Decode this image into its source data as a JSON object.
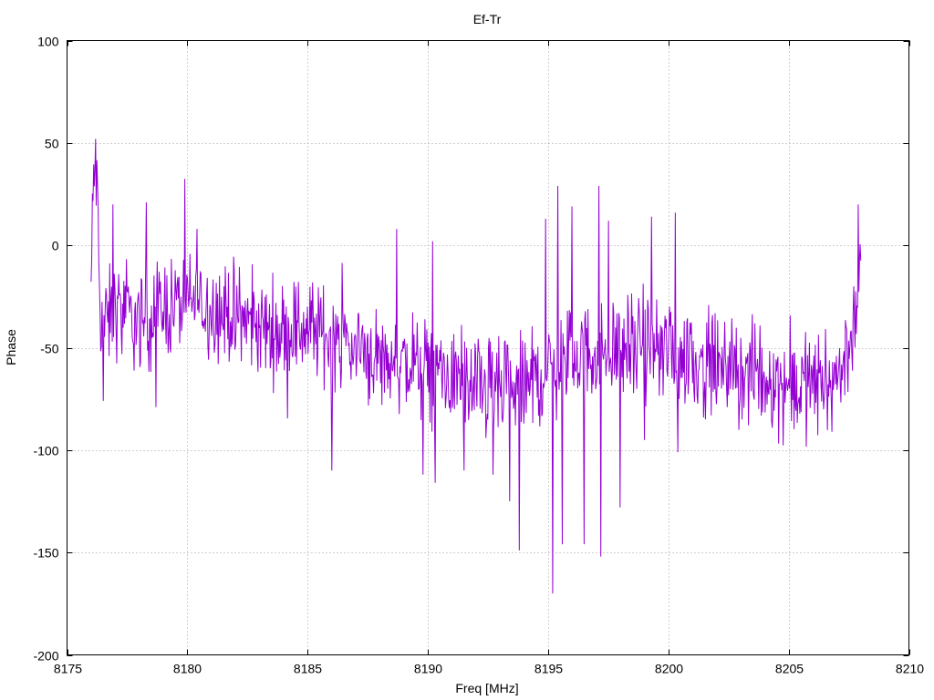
{
  "chart_data": {
    "type": "line",
    "title": "Ef-Tr",
    "xlabel": "Freq [MHz]",
    "ylabel": "Phase",
    "xlim": [
      8175,
      8210
    ],
    "ylim": [
      -200,
      100
    ],
    "xticks": [
      8175,
      8180,
      8185,
      8190,
      8195,
      8200,
      8205,
      8210
    ],
    "yticks": [
      -200,
      -150,
      -100,
      -50,
      0,
      50,
      100
    ],
    "grid": true,
    "legend": "none",
    "series": [
      {
        "color": "#9400d3",
        "x_start": 8176.0,
        "x_end": 8208.0,
        "points": 1200,
        "shape": [
          [
            8176.0,
            -20
          ],
          [
            8176.1,
            30
          ],
          [
            8176.2,
            40
          ],
          [
            8176.4,
            -35
          ],
          [
            8176.6,
            -40
          ],
          [
            8177.0,
            -30
          ],
          [
            8177.5,
            -35
          ],
          [
            8178.0,
            -38
          ],
          [
            8179.0,
            -30
          ],
          [
            8180.0,
            -28
          ],
          [
            8181.0,
            -30
          ],
          [
            8182.0,
            -35
          ],
          [
            8183.0,
            -40
          ],
          [
            8184.0,
            -42
          ],
          [
            8185.0,
            -40
          ],
          [
            8186.0,
            -45
          ],
          [
            8187.0,
            -50
          ],
          [
            8188.0,
            -55
          ],
          [
            8189.0,
            -58
          ],
          [
            8190.0,
            -60
          ],
          [
            8191.0,
            -65
          ],
          [
            8192.0,
            -70
          ],
          [
            8193.0,
            -72
          ],
          [
            8194.0,
            -70
          ],
          [
            8195.0,
            -62
          ],
          [
            8196.0,
            -55
          ],
          [
            8197.0,
            -52
          ],
          [
            8198.0,
            -50
          ],
          [
            8199.0,
            -50
          ],
          [
            8200.0,
            -52
          ],
          [
            8201.0,
            -55
          ],
          [
            8202.0,
            -60
          ],
          [
            8203.0,
            -62
          ],
          [
            8204.0,
            -65
          ],
          [
            8205.0,
            -68
          ],
          [
            8206.0,
            -68
          ],
          [
            8207.0,
            -65
          ],
          [
            8207.5,
            -50
          ],
          [
            8207.8,
            -30
          ],
          [
            8208.0,
            -10
          ]
        ],
        "noise_amplitude": 12,
        "spikes": [
          [
            8176.2,
            52
          ],
          [
            8176.5,
            -76
          ],
          [
            8176.9,
            20
          ],
          [
            8178.3,
            21
          ],
          [
            8178.7,
            -79
          ],
          [
            8180.4,
            8
          ],
          [
            8186.0,
            -110
          ],
          [
            8188.7,
            8
          ],
          [
            8189.8,
            -112
          ],
          [
            8190.2,
            2
          ],
          [
            8190.3,
            -116
          ],
          [
            8191.5,
            -110
          ],
          [
            8192.7,
            -112
          ],
          [
            8193.4,
            -125
          ],
          [
            8193.8,
            -149
          ],
          [
            8194.9,
            13
          ],
          [
            8195.2,
            -170
          ],
          [
            8195.4,
            29
          ],
          [
            8195.6,
            -146
          ],
          [
            8196.0,
            19
          ],
          [
            8196.5,
            -146
          ],
          [
            8197.1,
            29
          ],
          [
            8197.2,
            -152
          ],
          [
            8197.5,
            12
          ],
          [
            8198.0,
            -128
          ],
          [
            8199.0,
            -95
          ],
          [
            8199.3,
            14
          ],
          [
            8200.3,
            16
          ],
          [
            8200.4,
            -101
          ],
          [
            8207.9,
            20
          ]
        ]
      }
    ]
  }
}
